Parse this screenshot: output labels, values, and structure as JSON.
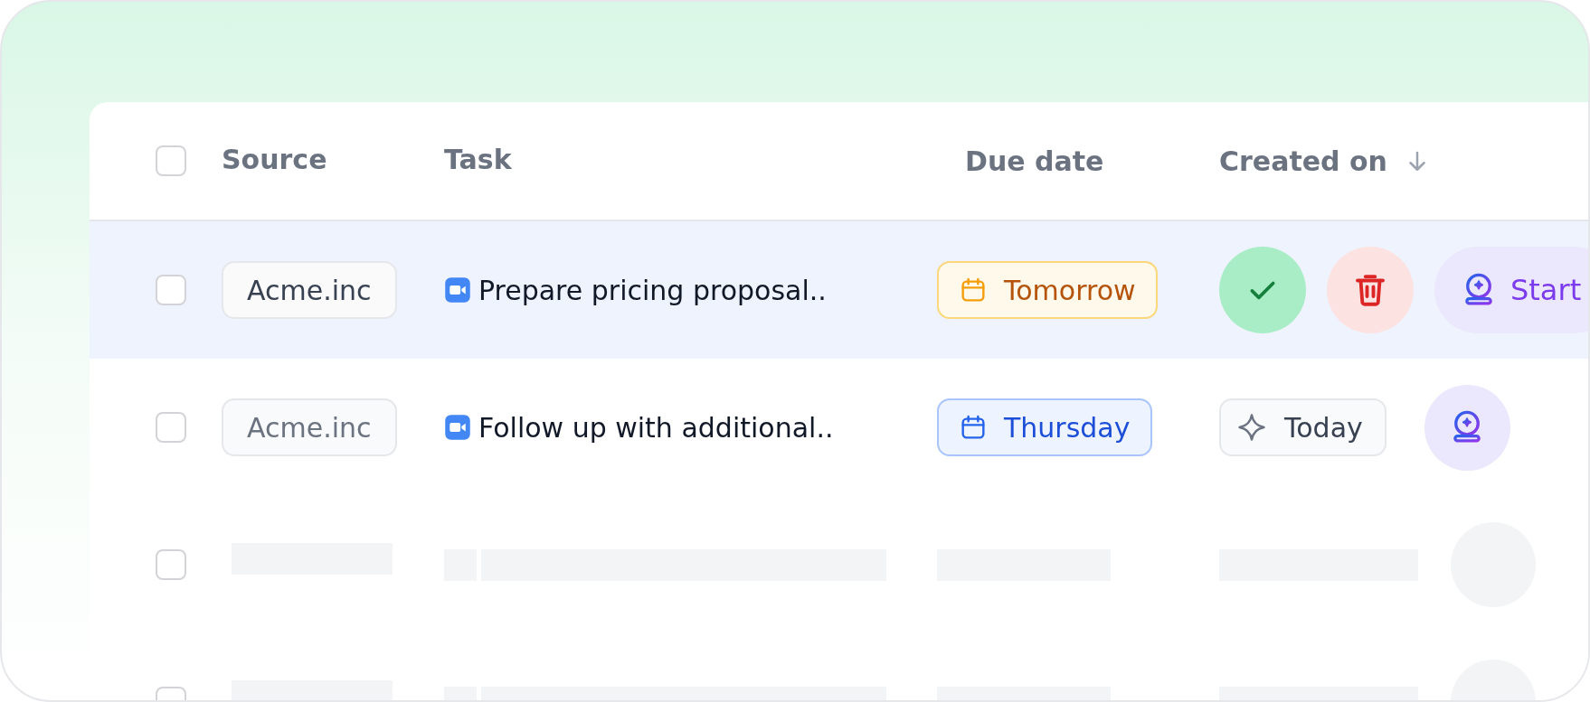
{
  "header": {
    "checked": false,
    "columns": [
      {
        "label": "Source",
        "sorted": false
      },
      {
        "label": "Task",
        "sorted": false
      },
      {
        "label": "Due date",
        "sorted": false
      },
      {
        "label": "Created on",
        "sorted": true
      }
    ]
  },
  "rows": [
    {
      "kind": "task",
      "selected": true,
      "checked": false,
      "source": "Acme.inc",
      "task": "Prepare pricing proposal..",
      "due": {
        "label": "Tomorrow",
        "color": "#f59e0b"
      },
      "actions": {
        "start_label": "Start"
      }
    },
    {
      "kind": "task",
      "selected": false,
      "checked": false,
      "source": "Acme.inc",
      "task": "Follow up with additional..",
      "due": {
        "label": "Thursday",
        "color": "#2563eb"
      },
      "created": "Today"
    },
    {
      "kind": "skeleton",
      "checked": false
    },
    {
      "kind": "skeleton",
      "checked": false
    }
  ]
}
